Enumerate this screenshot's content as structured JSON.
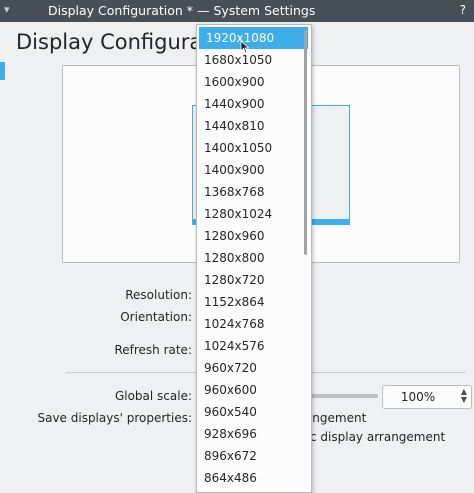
{
  "window": {
    "title": "Display Configuration * — System Settings",
    "help_glyph": "?"
  },
  "page": {
    "title": "Display Configuration"
  },
  "form": {
    "resolution_label": "Resolution:",
    "orientation_label": "Orientation:",
    "refresh_rate_label": "Refresh rate:",
    "global_scale_label": "Global scale:",
    "save_props_label": "Save displays' properties:",
    "global_scale_value": "100%",
    "save_option_1_suffix": "rangement",
    "save_option_2_suffix": "c display arrangement"
  },
  "resolution_dropdown": {
    "selected": "1920x1080",
    "options": [
      "1920x1080",
      "1680x1050",
      "1600x900",
      "1440x900",
      "1440x810",
      "1400x1050",
      "1400x900",
      "1368x768",
      "1280x1024",
      "1280x960",
      "1280x800",
      "1280x720",
      "1152x864",
      "1024x768",
      "1024x576",
      "960x720",
      "960x600",
      "960x540",
      "928x696",
      "896x672",
      "864x486"
    ]
  },
  "colors": {
    "accent": "#3daee9",
    "titlebar": "#475057",
    "background": "#eff0f1"
  }
}
